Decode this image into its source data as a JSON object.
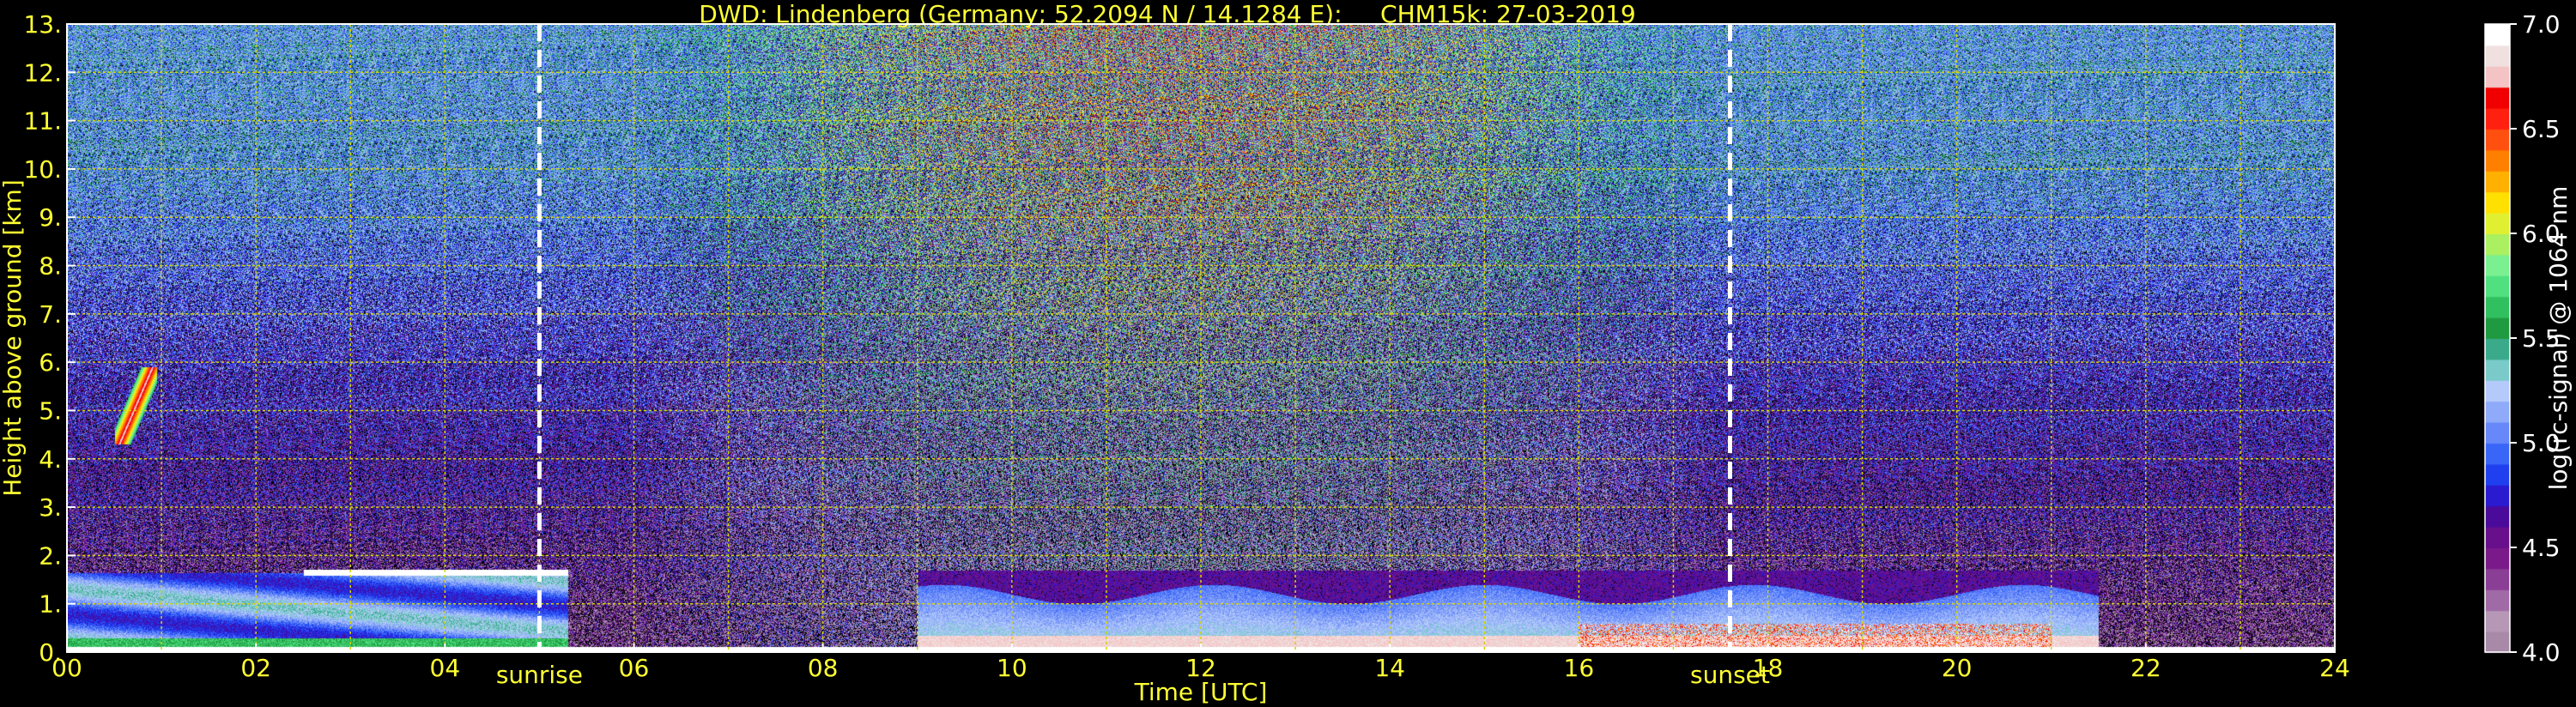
{
  "chart_data": {
    "type": "heatmap",
    "title": "DWD: Lindenberg (Germany; 52.2094 N / 14.1284 E):     CHM15k: 27-03-2019",
    "xlabel": "Time [UTC]",
    "ylabel": "Height above ground [km]",
    "xlim": [
      0,
      24
    ],
    "ylim": [
      0,
      13
    ],
    "x_ticks": [
      "00",
      "02",
      "04",
      "06",
      "08",
      "10",
      "12",
      "14",
      "16",
      "18",
      "20",
      "22",
      "24"
    ],
    "y_ticks": [
      "0.",
      "1.",
      "2.",
      "3.",
      "4.",
      "5.",
      "6.",
      "7.",
      "8.",
      "9.",
      "10.",
      "11.",
      "12.",
      "13."
    ],
    "grid": true,
    "vlines": [
      {
        "label": "sunrise",
        "x": 5.0
      },
      {
        "label": "sunset",
        "x": 17.6
      }
    ],
    "colorbar": {
      "label": "log(rc-signal) @ 1064 nm",
      "range": [
        4.0,
        7.0
      ],
      "ticks": [
        "4.0",
        "4.5",
        "5.0",
        "5.5",
        "6.0",
        "6.5",
        "7.0"
      ],
      "colors": [
        "#a88aa8",
        "#b697b6",
        "#a06aa6",
        "#8a3e96",
        "#7a1a8a",
        "#68108c",
        "#4a0a9a",
        "#2a1ad0",
        "#2040f0",
        "#3a66f8",
        "#6688f8",
        "#8eaaf8",
        "#b4cafa",
        "#7acaca",
        "#3aaa8a",
        "#209a40",
        "#30c060",
        "#50e080",
        "#7af090",
        "#aaf060",
        "#e0f030",
        "#ffe000",
        "#ffb000",
        "#ff8000",
        "#ff5010",
        "#ff2010",
        "#f00000",
        "#f4c4c4",
        "#f0e0e0",
        "#ffffff"
      ]
    },
    "features": [
      {
        "name": "boundary layer",
        "x_range": [
          0,
          5.3
        ],
        "top_km": 1.7
      },
      {
        "name": "cloud",
        "x": [
          0.5,
          0.9
        ],
        "height_km": [
          4.3,
          5.9
        ]
      },
      {
        "name": "aerosol layer",
        "x_range": [
          9,
          21.5
        ],
        "top_km": 1.7
      }
    ]
  },
  "colors": {
    "text": "#ffff33",
    "cbar_text": "#ffffff",
    "grid": "#d4d400",
    "background": "#000000"
  }
}
